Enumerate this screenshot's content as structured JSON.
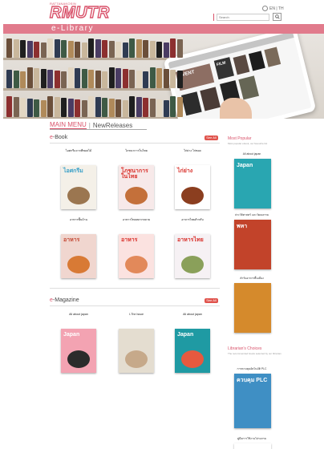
{
  "header": {
    "logo_top": "RATTANAKOSIN",
    "logo_text": "RMUTR",
    "lang_label": "EN | TH",
    "search_placeholder": "Search"
  },
  "band": {
    "title": "e-Library"
  },
  "hero": {
    "tablet_titles": [
      "EVENT",
      "FILM"
    ]
  },
  "tabs": {
    "main": "MAIN MENU",
    "separator": "|",
    "new": "NewReleases"
  },
  "ebook": {
    "title_accent": "e",
    "title_rest": "-Book",
    "all_label": "See All",
    "items": [
      {
        "title": "ไอศกรีมจากพืชผลไม้",
        "cover_text": "ไอศกรีม",
        "bg": "#f4f0e8",
        "text_color": "#3aa0c8",
        "food": "#9b7650"
      },
      {
        "title": "โภชนาการในไทย",
        "cover_text": "โภชนาการในไทย",
        "bg": "#f7e9e9",
        "text_color": "#d9302a",
        "food": "#c4703a"
      },
      {
        "title": "ไก่ย่าง ไก่ทอด",
        "cover_text": "ไก่ย่าง",
        "bg": "#ffffff",
        "text_color": "#d9302a",
        "food": "#8b3e1f"
      },
      {
        "title": "อาหารพื้นบ้าน",
        "cover_text": "อาหาร",
        "bg": "#f0d6cf",
        "text_color": "#c44a36",
        "food": "#d87a35"
      },
      {
        "title": "อาหารไทยหลากหลาย",
        "cover_text": "อาหาร",
        "bg": "#fbe2e0",
        "text_color": "#d9302a",
        "food": "#e2895a"
      },
      {
        "title": "อาหารไทยสำหรับ",
        "cover_text": "อาหารไทย",
        "bg": "#f6f1f4",
        "text_color": "#d9302a",
        "food": "#8aa05a"
      }
    ]
  },
  "magazine": {
    "title_accent": "e",
    "title_rest": "-Magazine",
    "all_label": "See All",
    "items": [
      {
        "title": "All about japan",
        "cover_text": "Japan",
        "bg": "#f3a3b2",
        "text_color": "#ffffff",
        "food": "#2b2b2b"
      },
      {
        "title": "I-The Issue",
        "cover_text": "",
        "bg": "#e4ddd0",
        "text_color": "#333333",
        "food": "#c6a98a"
      },
      {
        "title": "All about japan",
        "cover_text": "Japan",
        "bg": "#1f9aa3",
        "text_color": "#ffffff",
        "food": "#e6593f"
      }
    ]
  },
  "sidebar": {
    "popular_title": "Most Popular",
    "popular_sub": "Most popular ebook, our favourite list",
    "popular_items": [
      {
        "title": "All about japan",
        "cover_text": "Japan",
        "bg": "#29a6b1"
      },
      {
        "title": "ประวัติศาสตร์ และวัฒนธรรม",
        "cover_text": "พหา",
        "bg": "#c2432a"
      },
      {
        "title": "ตำรับอาหารพื้นเมือง",
        "cover_text": "",
        "bg": "#d58a2c"
      }
    ],
    "choices_title": "Librarian's Choices",
    "choices_sub": "The recommended books selected by our librarian",
    "choices_items": [
      {
        "title": "การควบคุมอัตโนมัติ PLC",
        "cover_text": "ควบคุม PLC",
        "bg": "#3f8fc4"
      },
      {
        "title": "คู่มือการใช้งานโปรแกรม",
        "cover_text": "",
        "bg": "#ffffff"
      }
    ]
  }
}
